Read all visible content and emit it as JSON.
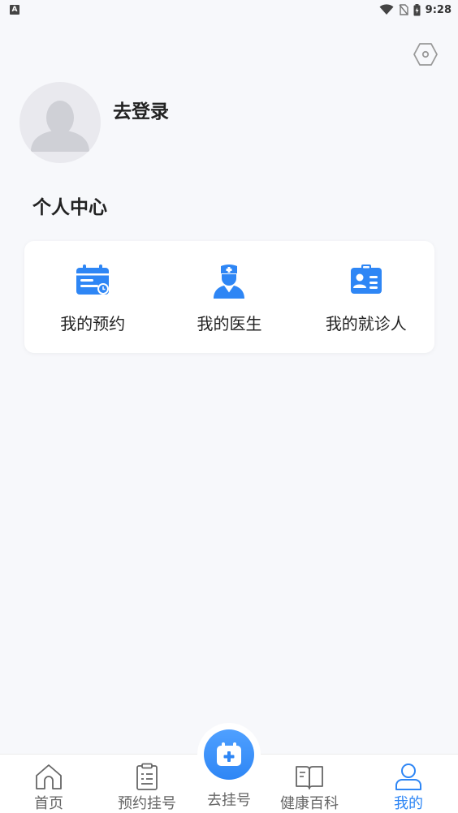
{
  "status_bar": {
    "badge": "A",
    "time": "9:28"
  },
  "profile": {
    "login_label": "去登录"
  },
  "section": {
    "title": "个人中心"
  },
  "menu": [
    {
      "label": "我的预约",
      "icon": "calendar-clock-icon"
    },
    {
      "label": "我的医生",
      "icon": "doctor-icon"
    },
    {
      "label": "我的就诊人",
      "icon": "id-card-icon"
    }
  ],
  "nav": {
    "home": "首页",
    "appointment": "预约挂号",
    "register": "去挂号",
    "health": "健康百科",
    "mine": "我的"
  },
  "colors": {
    "accent": "#2e86f5",
    "background": "#f7f8fb",
    "nav_inactive": "#666666"
  }
}
